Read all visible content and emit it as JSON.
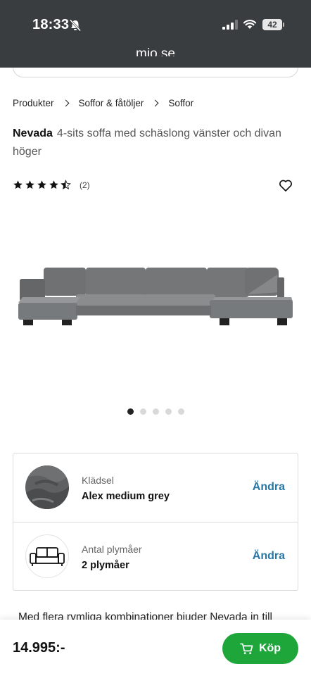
{
  "status_bar": {
    "time": "18:33",
    "battery": "42"
  },
  "browser": {
    "url": "mio.se"
  },
  "breadcrumb": [
    "Produkter",
    "Soffor & fåtöljer",
    "Soffor"
  ],
  "product": {
    "name": "Nevada",
    "subtitle": "4-sits soffa med schäslong vänster och divan höger",
    "rating": 4.5,
    "review_count": "(2)",
    "gallery": {
      "image_count": 5,
      "active_index": 0
    }
  },
  "options": [
    {
      "label": "Klädsel",
      "value": "Alex medium grey",
      "action": "Ändra"
    },
    {
      "label": "Antal plymåer",
      "value": "2 plymåer",
      "action": "Ändra"
    }
  ],
  "description_preview": "Med flera rymliga kombinationer bjuder Nevada in till",
  "purchase": {
    "price": "14.995:-",
    "buy_label": "Köp",
    "accent_color": "#1ea63b"
  },
  "colors": {
    "link": "#2477a8",
    "topbar": "#3a3d40"
  }
}
